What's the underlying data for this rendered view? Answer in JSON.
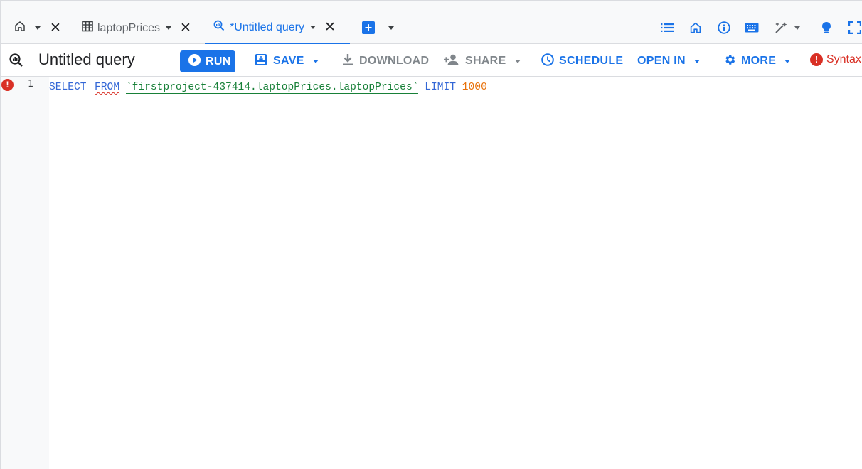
{
  "tabs": [
    {
      "label": "",
      "icon": "home-icon",
      "active": false
    },
    {
      "label": "laptopPrices",
      "icon": "table-icon",
      "active": false
    },
    {
      "label": "*Untitled query",
      "icon": "query-icon",
      "active": true
    }
  ],
  "toolbar": {
    "title": "Untitled query",
    "run_label": "RUN",
    "save_label": "SAVE",
    "download_label": "DOWNLOAD",
    "share_label": "SHARE",
    "schedule_label": "SCHEDULE",
    "open_in_label": "OPEN IN",
    "more_label": "MORE",
    "status_label": "Syntax"
  },
  "editor": {
    "line_number": "1",
    "tokens": {
      "select": "SELECT",
      "from": "FROM",
      "table": "`firstproject-437414.laptopPrices.laptopPrices`",
      "limit": "LIMIT",
      "limit_value": "1000"
    }
  },
  "colors": {
    "accent": "#1a73e8",
    "error": "#d93025",
    "keyword": "#3367d6",
    "table_ref": "#188038",
    "number": "#e8710a"
  }
}
